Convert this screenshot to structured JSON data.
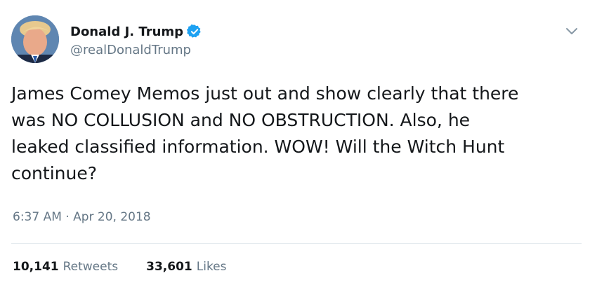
{
  "author": {
    "display_name": "Donald J. Trump",
    "handle": "@realDonaldTrump",
    "verified": true
  },
  "tweet": {
    "text": "James Comey Memos just out and show clearly that there\nwas NO COLLUSION and NO OBSTRUCTION. Also, he\nleaked classified information. WOW! Will the Witch Hunt\ncontinue?",
    "timestamp": "6:37 AM · Apr 20, 2018"
  },
  "stats": {
    "retweets_count": "10,141",
    "retweets_label": "Retweets",
    "likes_count": "33,601",
    "likes_label": "Likes"
  },
  "icons": {
    "verified": "verified-badge-icon",
    "menu": "chevron-down-icon"
  },
  "colors": {
    "text": "#14171a",
    "secondary": "#657786",
    "verified_blue": "#1da1f2",
    "divider": "#e1e8ed"
  }
}
